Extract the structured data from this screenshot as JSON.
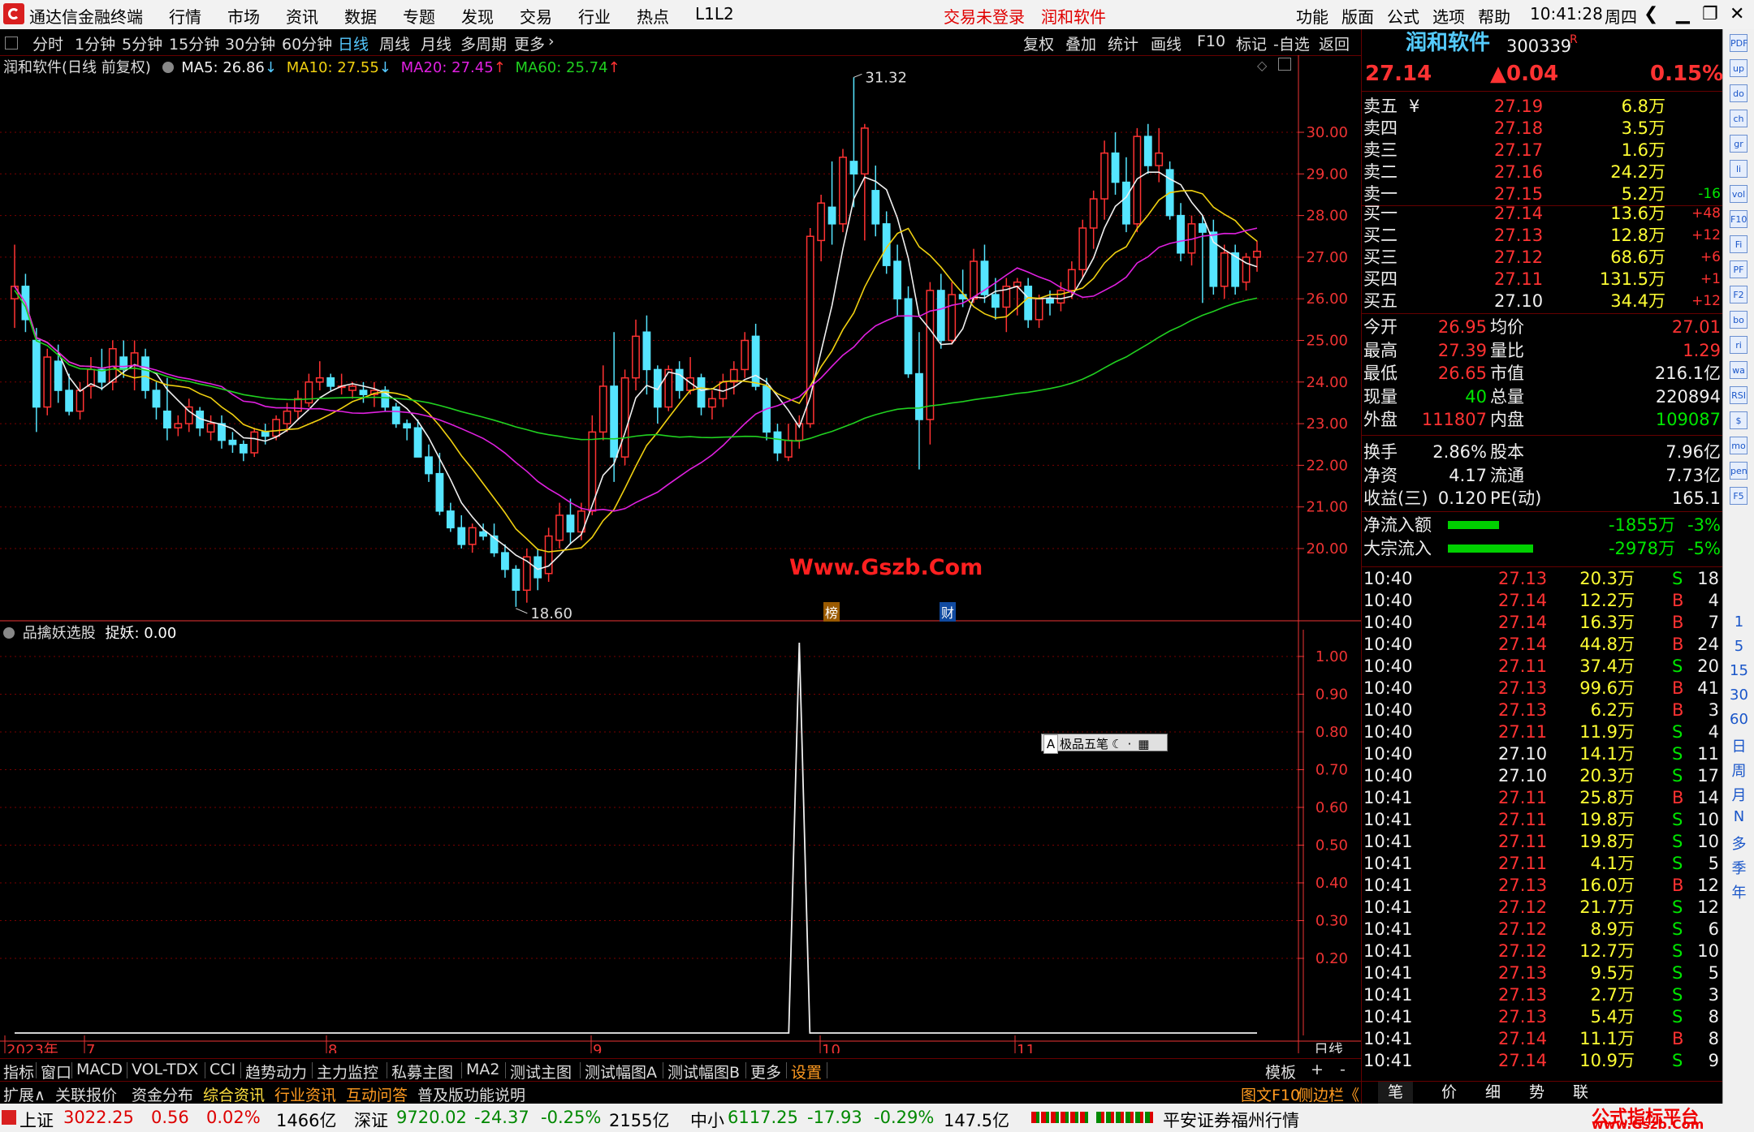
{
  "titlebar": {
    "app_name": "通达信金融终端",
    "menus": [
      "行情",
      "市场",
      "资讯",
      "数据",
      "专题",
      "发现",
      "交易",
      "行业",
      "热点",
      "L1L2"
    ],
    "login_status": "交易未登录",
    "stock_name": "润和软件",
    "right_menus": [
      "功能",
      "版面",
      "公式",
      "选项",
      "帮助"
    ],
    "time": "10:41:28",
    "weekday": "周四"
  },
  "period_tabs": [
    "分时",
    "1分钟",
    "5分钟",
    "15分钟",
    "30分钟",
    "60分钟",
    "日线",
    "周线",
    "月线",
    "多周期",
    "更多"
  ],
  "selected_period": "日线",
  "tools": [
    "复权",
    "叠加",
    "统计",
    "画线",
    "F10",
    "标记",
    "-自选",
    "返回"
  ],
  "main_chart": {
    "legend_title": "润和软件(日线 前复权)",
    "ma5": "MA5: 26.86",
    "ma10": "MA10: 27.55",
    "ma20": "MA20: 27.45",
    "ma60": "MA60: 25.74",
    "high_label": "31.32",
    "low_label": "18.60",
    "watermark": "Www.Gszb.Com",
    "markers": [
      "榜",
      "财"
    ]
  },
  "sub_chart": {
    "legend_title": "品擒妖选股",
    "legend_value": "捉妖: 0.00",
    "input_box_label": "极品五笔"
  },
  "chart_data": [
    {
      "type": "candlestick",
      "title": "润和软件(日线 前复权)",
      "ylim": [
        18.6,
        31.32
      ],
      "yticks": [
        20.0,
        21.0,
        22.0,
        23.0,
        24.0,
        25.0,
        26.0,
        27.0,
        28.0,
        29.0,
        30.0
      ],
      "x_tick_labels": [
        "2023年",
        "7",
        "8",
        "9",
        "10",
        "11"
      ],
      "candles": [
        [
          26.0,
          27.3,
          25.3,
          26.3
        ],
        [
          26.3,
          26.6,
          25.2,
          25.5
        ],
        [
          25.0,
          25.3,
          22.8,
          23.4
        ],
        [
          23.4,
          24.8,
          23.2,
          24.6
        ],
        [
          24.5,
          24.9,
          23.5,
          23.8
        ],
        [
          23.8,
          24.2,
          23.2,
          23.3
        ],
        [
          23.3,
          24.0,
          23.1,
          23.8
        ],
        [
          23.9,
          24.6,
          23.6,
          24.3
        ],
        [
          24.3,
          24.8,
          23.8,
          24.0
        ],
        [
          24.0,
          25.0,
          23.8,
          24.8
        ],
        [
          24.6,
          25.0,
          24.1,
          24.3
        ],
        [
          24.4,
          25.0,
          23.8,
          24.7
        ],
        [
          24.6,
          24.8,
          23.6,
          23.8
        ],
        [
          23.8,
          24.0,
          23.1,
          23.4
        ],
        [
          23.3,
          24.1,
          22.6,
          22.9
        ],
        [
          22.9,
          23.2,
          22.7,
          23.0
        ],
        [
          23.0,
          23.6,
          22.8,
          23.4
        ],
        [
          23.3,
          23.4,
          22.7,
          22.9
        ],
        [
          22.8,
          23.2,
          22.6,
          23.0
        ],
        [
          23.0,
          23.2,
          22.4,
          22.6
        ],
        [
          22.6,
          22.8,
          22.3,
          22.5
        ],
        [
          22.5,
          22.6,
          22.1,
          22.3
        ],
        [
          22.3,
          22.9,
          22.2,
          22.8
        ],
        [
          22.8,
          23.0,
          22.5,
          22.7
        ],
        [
          22.7,
          23.2,
          22.6,
          23.1
        ],
        [
          23.0,
          23.5,
          22.8,
          23.3
        ],
        [
          23.3,
          23.8,
          23.1,
          23.6
        ],
        [
          23.5,
          24.2,
          23.4,
          24.0
        ],
        [
          24.0,
          24.5,
          23.8,
          24.1
        ],
        [
          24.1,
          24.2,
          23.8,
          23.9
        ],
        [
          23.9,
          24.2,
          23.7,
          23.9
        ],
        [
          23.8,
          24.0,
          23.6,
          23.9
        ],
        [
          23.8,
          24.0,
          23.5,
          23.7
        ],
        [
          23.7,
          24.0,
          23.4,
          23.8
        ],
        [
          23.8,
          23.9,
          23.3,
          23.4
        ],
        [
          23.4,
          23.5,
          22.9,
          23.0
        ],
        [
          23.0,
          23.1,
          22.6,
          22.9
        ],
        [
          22.9,
          23.1,
          22.2,
          22.2
        ],
        [
          22.2,
          22.5,
          21.6,
          21.8
        ],
        [
          21.8,
          22.3,
          20.8,
          20.9
        ],
        [
          20.9,
          21.1,
          20.4,
          20.5
        ],
        [
          20.5,
          20.8,
          20.0,
          20.1
        ],
        [
          20.1,
          20.6,
          19.9,
          20.5
        ],
        [
          20.4,
          20.6,
          20.2,
          20.3
        ],
        [
          20.3,
          20.6,
          19.8,
          19.9
        ],
        [
          19.9,
          20.1,
          19.3,
          19.5
        ],
        [
          19.5,
          19.6,
          18.6,
          19.0
        ],
        [
          19.0,
          20.0,
          18.7,
          19.8
        ],
        [
          19.8,
          20.0,
          19.0,
          19.3
        ],
        [
          19.4,
          20.5,
          19.2,
          20.3
        ],
        [
          20.2,
          21.1,
          20.0,
          20.8
        ],
        [
          20.8,
          21.2,
          20.1,
          20.4
        ],
        [
          20.4,
          21.1,
          20.2,
          20.9
        ],
        [
          20.9,
          23.2,
          20.8,
          22.8
        ],
        [
          22.8,
          24.4,
          22.6,
          23.9
        ],
        [
          23.9,
          25.2,
          21.6,
          22.2
        ],
        [
          22.2,
          24.3,
          22.0,
          24.1
        ],
        [
          24.1,
          25.5,
          23.8,
          25.1
        ],
        [
          25.2,
          25.6,
          23.7,
          24.3
        ],
        [
          24.3,
          24.4,
          23.0,
          23.4
        ],
        [
          23.4,
          24.4,
          23.3,
          24.3
        ],
        [
          24.3,
          24.5,
          23.6,
          23.8
        ],
        [
          23.8,
          24.6,
          23.7,
          24.1
        ],
        [
          24.1,
          24.2,
          23.2,
          23.4
        ],
        [
          23.4,
          23.8,
          23.1,
          23.6
        ],
        [
          23.6,
          24.2,
          23.4,
          24.0
        ],
        [
          24.0,
          24.5,
          23.7,
          24.3
        ],
        [
          24.3,
          25.2,
          24.1,
          25.0
        ],
        [
          25.1,
          25.4,
          23.8,
          23.9
        ],
        [
          23.9,
          24.1,
          22.6,
          22.8
        ],
        [
          22.8,
          23.0,
          22.1,
          22.3
        ],
        [
          22.2,
          23.0,
          22.1,
          22.6
        ],
        [
          22.6,
          23.2,
          22.4,
          23.0
        ],
        [
          23.0,
          27.7,
          22.9,
          27.5
        ],
        [
          27.4,
          28.5,
          26.9,
          28.3
        ],
        [
          28.2,
          29.3,
          27.3,
          27.8
        ],
        [
          27.8,
          29.6,
          27.6,
          29.4
        ],
        [
          29.3,
          31.32,
          28.2,
          29.0
        ],
        [
          29.0,
          30.2,
          27.4,
          30.1
        ],
        [
          28.6,
          29.2,
          27.5,
          27.8
        ],
        [
          27.8,
          28.1,
          26.6,
          26.8
        ],
        [
          26.9,
          27.3,
          25.6,
          26.0
        ],
        [
          26.0,
          26.3,
          24.1,
          24.2
        ],
        [
          24.2,
          25.2,
          21.9,
          23.1
        ],
        [
          23.1,
          26.4,
          22.5,
          26.2
        ],
        [
          26.2,
          26.6,
          24.8,
          25.0
        ],
        [
          25.0,
          26.4,
          24.9,
          26.1
        ],
        [
          26.1,
          26.7,
          25.8,
          26.0
        ],
        [
          26.0,
          27.2,
          25.9,
          26.9
        ],
        [
          26.9,
          27.3,
          25.9,
          26.1
        ],
        [
          26.1,
          26.5,
          25.5,
          25.8
        ],
        [
          25.8,
          26.5,
          25.2,
          26.3
        ],
        [
          26.3,
          26.5,
          25.6,
          26.4
        ],
        [
          26.3,
          26.5,
          25.3,
          25.5
        ],
        [
          25.5,
          26.1,
          25.3,
          26.0
        ],
        [
          26.0,
          26.2,
          25.6,
          25.9
        ],
        [
          25.9,
          26.4,
          25.7,
          26.2
        ],
        [
          26.2,
          26.9,
          26.0,
          26.7
        ],
        [
          26.7,
          27.9,
          26.5,
          27.7
        ],
        [
          27.7,
          28.6,
          27.2,
          28.4
        ],
        [
          28.4,
          29.8,
          27.9,
          29.5
        ],
        [
          29.5,
          30.0,
          28.5,
          28.8
        ],
        [
          28.8,
          29.4,
          27.6,
          27.8
        ],
        [
          27.8,
          30.1,
          27.6,
          29.9
        ],
        [
          29.9,
          30.2,
          29.0,
          29.2
        ],
        [
          29.2,
          30.1,
          28.8,
          29.5
        ],
        [
          29.1,
          29.3,
          27.9,
          28.0
        ],
        [
          28.0,
          28.3,
          26.9,
          27.1
        ],
        [
          27.1,
          28.0,
          26.8,
          27.8
        ],
        [
          27.8,
          28.0,
          25.9,
          27.6
        ],
        [
          27.6,
          27.9,
          26.1,
          26.3
        ],
        [
          26.3,
          27.3,
          26.0,
          27.1
        ],
        [
          27.1,
          27.3,
          26.1,
          26.3
        ],
        [
          26.4,
          27.1,
          26.2,
          27.0
        ],
        [
          27.0,
          27.39,
          26.65,
          27.14
        ]
      ],
      "ma_series": [
        {
          "name": "MA5",
          "color": "#f0f0f0",
          "last": 26.86
        },
        {
          "name": "MA10",
          "color": "#f0d010",
          "last": 27.55
        },
        {
          "name": "MA20",
          "color": "#e020e0",
          "last": 27.45
        },
        {
          "name": "MA60",
          "color": "#20d020",
          "last": 25.74
        }
      ]
    },
    {
      "type": "line",
      "title": "品擒妖选股",
      "ylim": [
        0,
        1.0
      ],
      "yticks": [
        0.2,
        0.3,
        0.4,
        0.5,
        0.6,
        0.7,
        0.8,
        0.9,
        1.0
      ],
      "series": [
        {
          "name": "捉妖",
          "spike_index": 72,
          "values_desc": "0 everywhere except 1.00 at spike"
        }
      ]
    }
  ],
  "quote_panel": {
    "stock_name": "润和软件",
    "stock_code": "300339",
    "code_suffix": "R",
    "price": "27.14",
    "change": "▲0.04",
    "change_pct": "0.15%",
    "asks": [
      {
        "label": "卖五",
        "flag": "¥",
        "price": "27.19",
        "vol": "6.8万",
        "delta": ""
      },
      {
        "label": "卖四",
        "flag": "",
        "price": "27.18",
        "vol": "3.5万",
        "delta": ""
      },
      {
        "label": "卖三",
        "flag": "",
        "price": "27.17",
        "vol": "1.6万",
        "delta": ""
      },
      {
        "label": "卖二",
        "flag": "",
        "price": "27.16",
        "vol": "24.2万",
        "delta": ""
      },
      {
        "label": "卖一",
        "flag": "",
        "price": "27.15",
        "vol": "5.2万",
        "delta": "-16"
      }
    ],
    "bids": [
      {
        "label": "买一",
        "price": "27.14",
        "vol": "13.6万",
        "delta": "+48"
      },
      {
        "label": "买二",
        "price": "27.13",
        "vol": "12.8万",
        "delta": "+12"
      },
      {
        "label": "买三",
        "price": "27.12",
        "vol": "68.6万",
        "delta": "+6"
      },
      {
        "label": "买四",
        "price": "27.11",
        "vol": "131.5万",
        "delta": "+1"
      },
      {
        "label": "买五",
        "price": "27.10",
        "vol": "34.4万",
        "delta": "+12"
      }
    ],
    "stats1": [
      {
        "l1": "今开",
        "v1": "26.95",
        "l2": "均价",
        "v2": "27.01"
      },
      {
        "l1": "最高",
        "v1": "27.39",
        "l2": "量比",
        "v2": "1.29"
      },
      {
        "l1": "最低",
        "v1": "26.65",
        "l2": "市值",
        "v2": "216.1亿"
      },
      {
        "l1": "现量",
        "v1": "40",
        "l2": "总量",
        "v2": "220894"
      },
      {
        "l1": "外盘",
        "v1": "111807",
        "l2": "内盘",
        "v2": "109087"
      }
    ],
    "stats2": [
      {
        "l1": "换手",
        "v1": "2.86%",
        "l2": "股本",
        "v2": "7.96亿"
      },
      {
        "l1": "净资",
        "v1": "4.17",
        "l2": "流通",
        "v2": "7.73亿"
      },
      {
        "l1": "收益(三)",
        "v1": "0.120",
        "l2": "PE(动)",
        "v2": "165.1"
      }
    ],
    "flows": [
      {
        "label": "净流入额",
        "value": "-1855万",
        "pct": "-3%",
        "bar": 0.3
      },
      {
        "label": "大宗流入",
        "value": "-2978万",
        "pct": "-5%",
        "bar": 0.5
      }
    ],
    "ticks": [
      [
        "10:40",
        "27.13",
        "20.3万",
        "S",
        "18"
      ],
      [
        "10:40",
        "27.14",
        "12.2万",
        "B",
        "4"
      ],
      [
        "10:40",
        "27.14",
        "16.3万",
        "B",
        "7"
      ],
      [
        "10:40",
        "27.14",
        "44.8万",
        "B",
        "24"
      ],
      [
        "10:40",
        "27.11",
        "37.4万",
        "S",
        "20"
      ],
      [
        "10:40",
        "27.13",
        "99.6万",
        "B",
        "41"
      ],
      [
        "10:40",
        "27.13",
        "6.2万",
        "B",
        "3"
      ],
      [
        "10:40",
        "27.11",
        "11.9万",
        "S",
        "4"
      ],
      [
        "10:40",
        "27.10",
        "14.1万",
        "S",
        "11"
      ],
      [
        "10:40",
        "27.10",
        "20.3万",
        "S",
        "17"
      ],
      [
        "10:41",
        "27.11",
        "25.8万",
        "B",
        "14"
      ],
      [
        "10:41",
        "27.11",
        "19.8万",
        "S",
        "10"
      ],
      [
        "10:41",
        "27.11",
        "19.8万",
        "S",
        "10"
      ],
      [
        "10:41",
        "27.11",
        "4.1万",
        "S",
        "5"
      ],
      [
        "10:41",
        "27.13",
        "16.0万",
        "B",
        "12"
      ],
      [
        "10:41",
        "27.12",
        "21.7万",
        "S",
        "12"
      ],
      [
        "10:41",
        "27.12",
        "8.9万",
        "S",
        "6"
      ],
      [
        "10:41",
        "27.12",
        "12.7万",
        "S",
        "10"
      ],
      [
        "10:41",
        "27.13",
        "9.5万",
        "S",
        "5"
      ],
      [
        "10:41",
        "27.13",
        "2.7万",
        "S",
        "3"
      ],
      [
        "10:41",
        "27.13",
        "5.4万",
        "S",
        "8"
      ],
      [
        "10:41",
        "27.14",
        "11.1万",
        "B",
        "8"
      ],
      [
        "10:41",
        "27.14",
        "10.9万",
        "S",
        "9"
      ]
    ],
    "bottom_tabs": [
      "笔",
      "价",
      "细",
      "势",
      "联"
    ]
  },
  "sidebar": {
    "icons": [
      "PDF",
      "up",
      "down",
      "chart",
      "grid",
      "line",
      "vol",
      "F10",
      "Fi",
      "PF",
      "F2",
      "book",
      "ring",
      "wave",
      "RSI",
      "$",
      "move",
      "pen",
      "F5"
    ],
    "labels": [
      "1",
      "5",
      "15",
      "30",
      "60",
      "日",
      "周",
      "月",
      "N",
      "多",
      "季",
      "年"
    ]
  },
  "bottom_bar1": {
    "tabs": [
      "指标",
      "窗口",
      "MACD",
      "VOL-TDX",
      "CCI",
      "趋势动力",
      "主力监控",
      "私募主图",
      "MA2",
      "测试主图",
      "测试幅图A",
      "测试幅图B",
      "更多",
      "设置"
    ],
    "right": [
      "模板",
      "+",
      "-"
    ],
    "period_label": "日线"
  },
  "bottom_bar2": {
    "tabs": [
      "扩展∧",
      "关联报价",
      "资金分布",
      "综合资讯",
      "行业资讯",
      "互动问答",
      "普及版功能说明"
    ],
    "right_label": "图文F10",
    "side_label": "侧边栏《"
  },
  "statusbar": {
    "sh_name": "上证",
    "sh_val": "3022.25",
    "sh_chg": "0.56",
    "sh_pct": "0.02%",
    "sh_amt": "1466亿",
    "sz_name": "深证",
    "sz_val": "9720.02",
    "sz_chg": "-24.37",
    "sz_pct": "-0.25%",
    "sz_amt": "2155亿",
    "zx_name": "中小",
    "zx_val": "6117.25",
    "zx_chg": "-17.93",
    "zx_pct": "-0.29%",
    "zx_amt": "147.5亿",
    "broker": "平安证券福州行情",
    "brand": "公式指标平台",
    "brand_url": "www.Gszb.Com"
  },
  "colors": {
    "up": "#ff3232",
    "down": "#55e5ff",
    "grid": "#7a0000",
    "ma5": "#f0f0f0",
    "ma10": "#f0d010",
    "ma20": "#e020e0",
    "ma60": "#20d020"
  }
}
